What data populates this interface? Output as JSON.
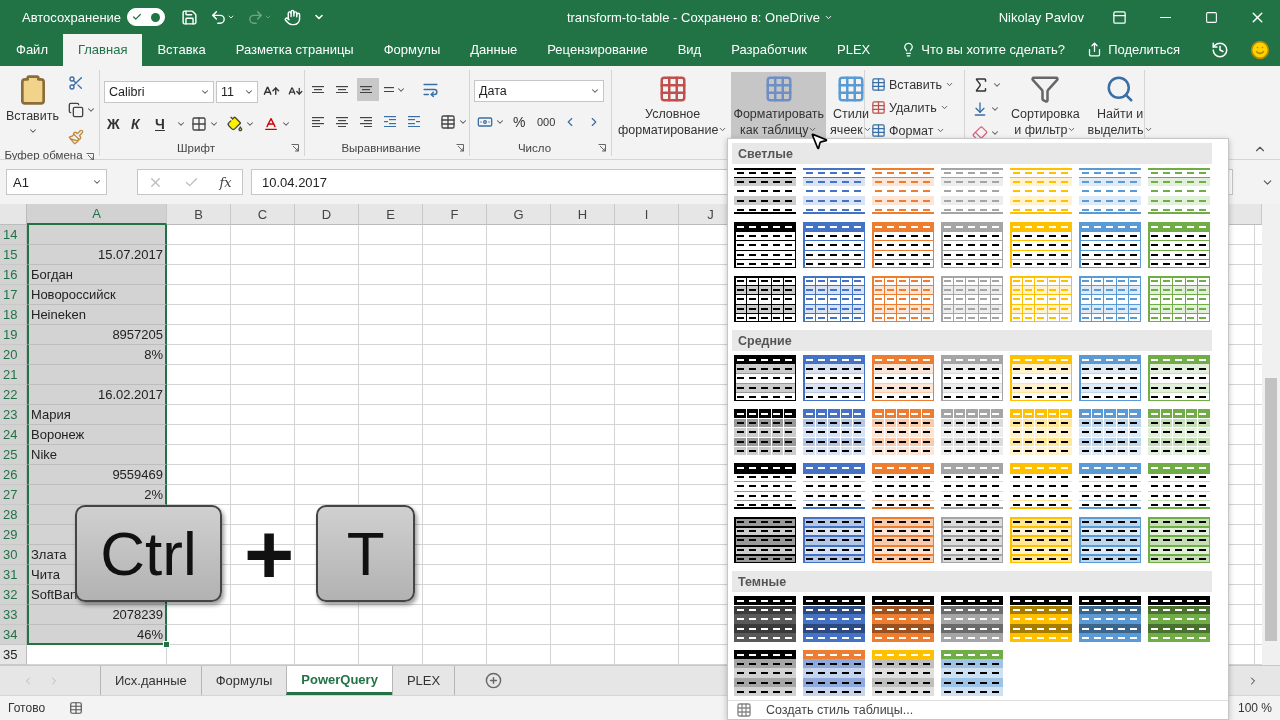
{
  "title_bar": {
    "autosave_label": "Автосохранение",
    "autosave_on": true,
    "redo_disabled": true,
    "title": "transform-to-table  -  Сохранено в: OneDrive",
    "user": "Nikolay Pavlov"
  },
  "tabs": [
    {
      "label": "Файл",
      "selected": false
    },
    {
      "label": "Главная",
      "selected": true
    },
    {
      "label": "Вставка",
      "selected": false
    },
    {
      "label": "Разметка страницы",
      "selected": false
    },
    {
      "label": "Формулы",
      "selected": false
    },
    {
      "label": "Данные",
      "selected": false
    },
    {
      "label": "Рецензирование",
      "selected": false
    },
    {
      "label": "Вид",
      "selected": false
    },
    {
      "label": "Разработчик",
      "selected": false
    },
    {
      "label": "PLEX",
      "selected": false
    }
  ],
  "tell_me": "Что вы хотите сделать?",
  "share": "Поделиться",
  "ribbon": {
    "clipboard": {
      "paste": "Вставить",
      "label": "Буфер обмена"
    },
    "font": {
      "name": "Calibri",
      "size": "11",
      "bold": "Ж",
      "italic": "К",
      "underline": "Ч",
      "label": "Шрифт"
    },
    "alignment": {
      "vertical": [
        {
          "selected": false
        },
        {
          "selected": false
        },
        {
          "selected": true
        }
      ],
      "label": "Выравнивание"
    },
    "number": {
      "format": "Дата",
      "percent": "%",
      "thousands": "000",
      "label": "Число"
    },
    "styles": [
      {
        "label": "Условное\nформатирование",
        "pressed": false
      },
      {
        "label": "Форматировать\nкак таблицу",
        "pressed": true
      },
      {
        "label": "Стили\nячеек",
        "pressed": false
      }
    ],
    "cells": [
      "Вставить",
      "Удалить",
      "Формат"
    ],
    "editing": [
      "Сортировка\nи фильтр",
      "Найти и\nвыделить"
    ]
  },
  "formula_bar": {
    "name_box": "A1",
    "fx": "fx",
    "value": "10.04.2017"
  },
  "sheet": {
    "columns": [
      {
        "label": "A",
        "selected": true
      },
      {
        "label": "B",
        "selected": false
      },
      {
        "label": "C",
        "selected": false
      },
      {
        "label": "D",
        "selected": false
      },
      {
        "label": "E",
        "selected": false
      },
      {
        "label": "F",
        "selected": false
      },
      {
        "label": "G",
        "selected": false
      },
      {
        "label": "H",
        "selected": false
      },
      {
        "label": "I",
        "selected": false
      },
      {
        "label": "J",
        "selected": false
      }
    ],
    "rows": [
      {
        "number": "14",
        "selected": true
      },
      {
        "number": "15",
        "selected": true,
        "a": {
          "text": "15.07.2017",
          "kind": "number"
        }
      },
      {
        "number": "16",
        "selected": true,
        "a": {
          "text": "Богдан",
          "kind": "text"
        }
      },
      {
        "number": "17",
        "selected": true,
        "a": {
          "text": "Новороссийск",
          "kind": "text"
        }
      },
      {
        "number": "18",
        "selected": true,
        "a": {
          "text": "Heineken",
          "kind": "text"
        }
      },
      {
        "number": "19",
        "selected": true,
        "a": {
          "text": "8957205",
          "kind": "number"
        }
      },
      {
        "number": "20",
        "selected": true,
        "a": {
          "text": "8%",
          "kind": "number"
        }
      },
      {
        "number": "21",
        "selected": true
      },
      {
        "number": "22",
        "selected": true,
        "a": {
          "text": "16.02.2017",
          "kind": "number"
        }
      },
      {
        "number": "23",
        "selected": true,
        "a": {
          "text": "Мария",
          "kind": "text"
        }
      },
      {
        "number": "24",
        "selected": true,
        "a": {
          "text": "Воронеж",
          "kind": "text"
        }
      },
      {
        "number": "25",
        "selected": true,
        "a": {
          "text": "Nike",
          "kind": "text"
        }
      },
      {
        "number": "26",
        "selected": true,
        "a": {
          "text": "9559469",
          "kind": "number"
        }
      },
      {
        "number": "27",
        "selected": true,
        "a": {
          "text": "2%",
          "kind": "number"
        }
      },
      {
        "number": "28",
        "selected": true
      },
      {
        "number": "29",
        "selected": true
      },
      {
        "number": "30",
        "selected": true,
        "a": {
          "text": "Злата",
          "kind": "text"
        }
      },
      {
        "number": "31",
        "selected": true,
        "a": {
          "text": "Чита",
          "kind": "text"
        }
      },
      {
        "number": "32",
        "selected": true,
        "a": {
          "text": "SoftBan",
          "kind": "text"
        }
      },
      {
        "number": "33",
        "selected": true,
        "a": {
          "text": "2078239",
          "kind": "number"
        }
      },
      {
        "number": "34",
        "selected": true,
        "a": {
          "text": "46%",
          "kind": "number"
        }
      },
      {
        "number": "35",
        "selected": false
      }
    ]
  },
  "shortcut": {
    "keys": [
      "Ctrl",
      "T"
    ],
    "joiner": "+"
  },
  "sheet_tabs": [
    {
      "label": "Исх.данные",
      "selected": false
    },
    {
      "label": "Формулы",
      "selected": false
    },
    {
      "label": "PowerQuery",
      "selected": true
    },
    {
      "label": "PLEX",
      "selected": false
    }
  ],
  "status": {
    "text": "Готово",
    "zoom": "100 %"
  },
  "gallery": {
    "sections": [
      {
        "title": "Светлые",
        "styles": [
          {
            "kind": "light-lines",
            "color": "#000000"
          },
          {
            "kind": "light-lines",
            "color": "#4472c4"
          },
          {
            "kind": "light-lines",
            "color": "#ed7d31"
          },
          {
            "kind": "light-lines",
            "color": "#a5a5a5"
          },
          {
            "kind": "light-lines",
            "color": "#ffc000"
          },
          {
            "kind": "light-lines",
            "color": "#5b9bd5"
          },
          {
            "kind": "light-lines",
            "color": "#70ad47"
          },
          {
            "kind": "light-header",
            "color": "#000000"
          },
          {
            "kind": "light-header",
            "color": "#4472c4"
          },
          {
            "kind": "light-header",
            "color": "#ed7d31"
          },
          {
            "kind": "light-header",
            "color": "#a5a5a5"
          },
          {
            "kind": "light-header",
            "color": "#ffc000"
          },
          {
            "kind": "light-header",
            "color": "#5b9bd5"
          },
          {
            "kind": "light-header",
            "color": "#70ad47"
          },
          {
            "kind": "light-grid",
            "color": "#000000"
          },
          {
            "kind": "light-grid",
            "color": "#4472c4"
          },
          {
            "kind": "light-grid",
            "color": "#ed7d31"
          },
          {
            "kind": "light-grid",
            "color": "#a5a5a5"
          },
          {
            "kind": "light-grid",
            "color": "#ffc000"
          },
          {
            "kind": "light-grid",
            "color": "#5b9bd5"
          },
          {
            "kind": "light-grid",
            "color": "#70ad47"
          }
        ]
      },
      {
        "title": "Средние",
        "styles": [
          {
            "kind": "medium-header",
            "color": "#000000"
          },
          {
            "kind": "medium-header",
            "color": "#4472c4"
          },
          {
            "kind": "medium-header",
            "color": "#ed7d31"
          },
          {
            "kind": "medium-header",
            "color": "#a5a5a5"
          },
          {
            "kind": "medium-header",
            "color": "#ffc000"
          },
          {
            "kind": "medium-header",
            "color": "#5b9bd5"
          },
          {
            "kind": "medium-header",
            "color": "#70ad47"
          },
          {
            "kind": "medium-banded",
            "color": "#000000"
          },
          {
            "kind": "medium-banded",
            "color": "#4472c4"
          },
          {
            "kind": "medium-banded",
            "color": "#ed7d31"
          },
          {
            "kind": "medium-banded",
            "color": "#a5a5a5"
          },
          {
            "kind": "medium-banded",
            "color": "#ffc000"
          },
          {
            "kind": "medium-banded",
            "color": "#5b9bd5"
          },
          {
            "kind": "medium-banded",
            "color": "#70ad47"
          },
          {
            "kind": "medium-lines",
            "color": "#000000"
          },
          {
            "kind": "medium-lines",
            "color": "#4472c4"
          },
          {
            "kind": "medium-lines",
            "color": "#ed7d31"
          },
          {
            "kind": "medium-lines",
            "color": "#a5a5a5"
          },
          {
            "kind": "medium-lines",
            "color": "#ffc000"
          },
          {
            "kind": "medium-lines",
            "color": "#5b9bd5"
          },
          {
            "kind": "medium-lines",
            "color": "#70ad47"
          },
          {
            "kind": "medium-fill",
            "color": "#000000"
          },
          {
            "kind": "medium-fill",
            "color": "#4472c4"
          },
          {
            "kind": "medium-fill",
            "color": "#ed7d31"
          },
          {
            "kind": "medium-fill",
            "color": "#a5a5a5"
          },
          {
            "kind": "medium-fill",
            "color": "#ffc000"
          },
          {
            "kind": "medium-fill",
            "color": "#5b9bd5"
          },
          {
            "kind": "medium-fill",
            "color": "#70ad47"
          }
        ]
      },
      {
        "title": "Темные",
        "styles": [
          {
            "kind": "dark",
            "color": "#595959"
          },
          {
            "kind": "dark",
            "color": "#4472c4"
          },
          {
            "kind": "dark",
            "color": "#ed7d31"
          },
          {
            "kind": "dark",
            "color": "#a5a5a5"
          },
          {
            "kind": "dark",
            "color": "#ffc000"
          },
          {
            "kind": "dark",
            "color": "#5b9bd5"
          },
          {
            "kind": "dark",
            "color": "#70ad47"
          },
          {
            "kind": "dark-light",
            "color": "#000000",
            "band": {
              "color": "#a5a5a5"
            }
          },
          {
            "kind": "dark-light",
            "color": "#ed7d31",
            "band": {
              "color": "#8ea9db"
            }
          },
          {
            "kind": "dark-light",
            "color": "#ffc000",
            "band": {
              "color": "#bfbfbf"
            }
          },
          {
            "kind": "dark-light",
            "color": "#70ad47",
            "band": {
              "color": "#9dc3e6"
            }
          }
        ]
      }
    ],
    "footer": "Создать стиль таблицы..."
  }
}
